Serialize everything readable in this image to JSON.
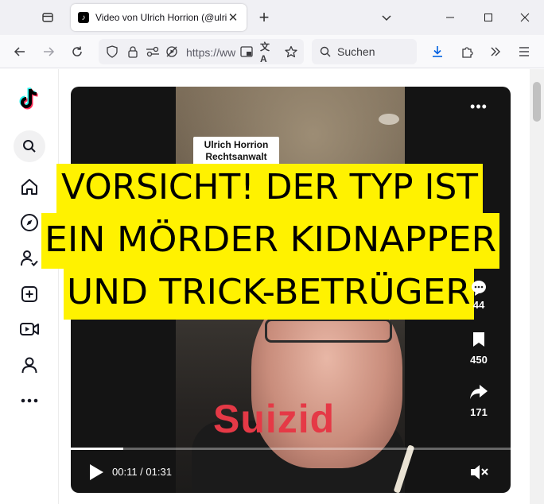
{
  "browser": {
    "tab_title": "Video von Ulrich Horrion (@ulrich",
    "url": "https://www",
    "search_placeholder": "Suchen"
  },
  "video": {
    "name_tag_line1": "Ulrich Horrion",
    "name_tag_line2": "Rechtsanwalt",
    "overlay_line1": "VORSICHT! DER TYP IST",
    "overlay_line2": "EIN MÖRDER KIDNAPPER",
    "overlay_line3": "UND TRICK-BETRÜGER",
    "caption_word": "Suizid",
    "comments_count": "44",
    "saves_count": "450",
    "shares_count": "171",
    "time_display": "00:11 / 01:31",
    "progress": 0.12
  },
  "colors": {
    "overlay_bg": "#fff200",
    "caption_red": "#e53946",
    "tiktok_cyan": "#25f4ee",
    "tiktok_pink": "#fe2c55"
  },
  "icons": {
    "sidebar": [
      "tiktok-logo-icon",
      "search-icon",
      "home-icon",
      "explore-compass-icon",
      "following-icon",
      "upload-plus-icon",
      "live-video-icon",
      "profile-icon",
      "more-icon"
    ],
    "actions": [
      "comment-icon",
      "bookmark-icon",
      "share-icon"
    ]
  }
}
